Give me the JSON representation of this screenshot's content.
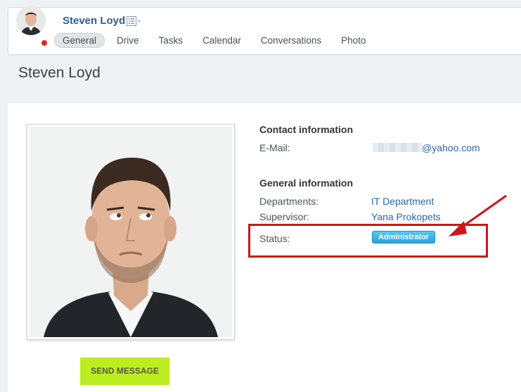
{
  "header": {
    "user_name": "Steven Loyd",
    "tabs": [
      {
        "label": "General",
        "active": true
      },
      {
        "label": "Drive"
      },
      {
        "label": "Tasks"
      },
      {
        "label": "Calendar"
      },
      {
        "label": "Conversations"
      },
      {
        "label": "Photo"
      }
    ],
    "status_color": "#e3261f"
  },
  "page": {
    "title": "Steven Loyd"
  },
  "contact": {
    "title": "Contact information",
    "email_label": "E-Mail:",
    "email_domain": "@yahoo.com"
  },
  "general": {
    "title": "General information",
    "departments_label": "Departments:",
    "departments_value": "IT Department",
    "supervisor_label": "Supervisor:",
    "supervisor_value": "Yana Prokopets",
    "status_label": "Status:",
    "status_badge": "Administrator"
  },
  "actions": {
    "send_message": "SEND MESSAGE"
  },
  "colors": {
    "accent": "#2b67a8",
    "button": "#bbed21",
    "highlight": "#d3131b",
    "badge": "#2aa3dc"
  }
}
